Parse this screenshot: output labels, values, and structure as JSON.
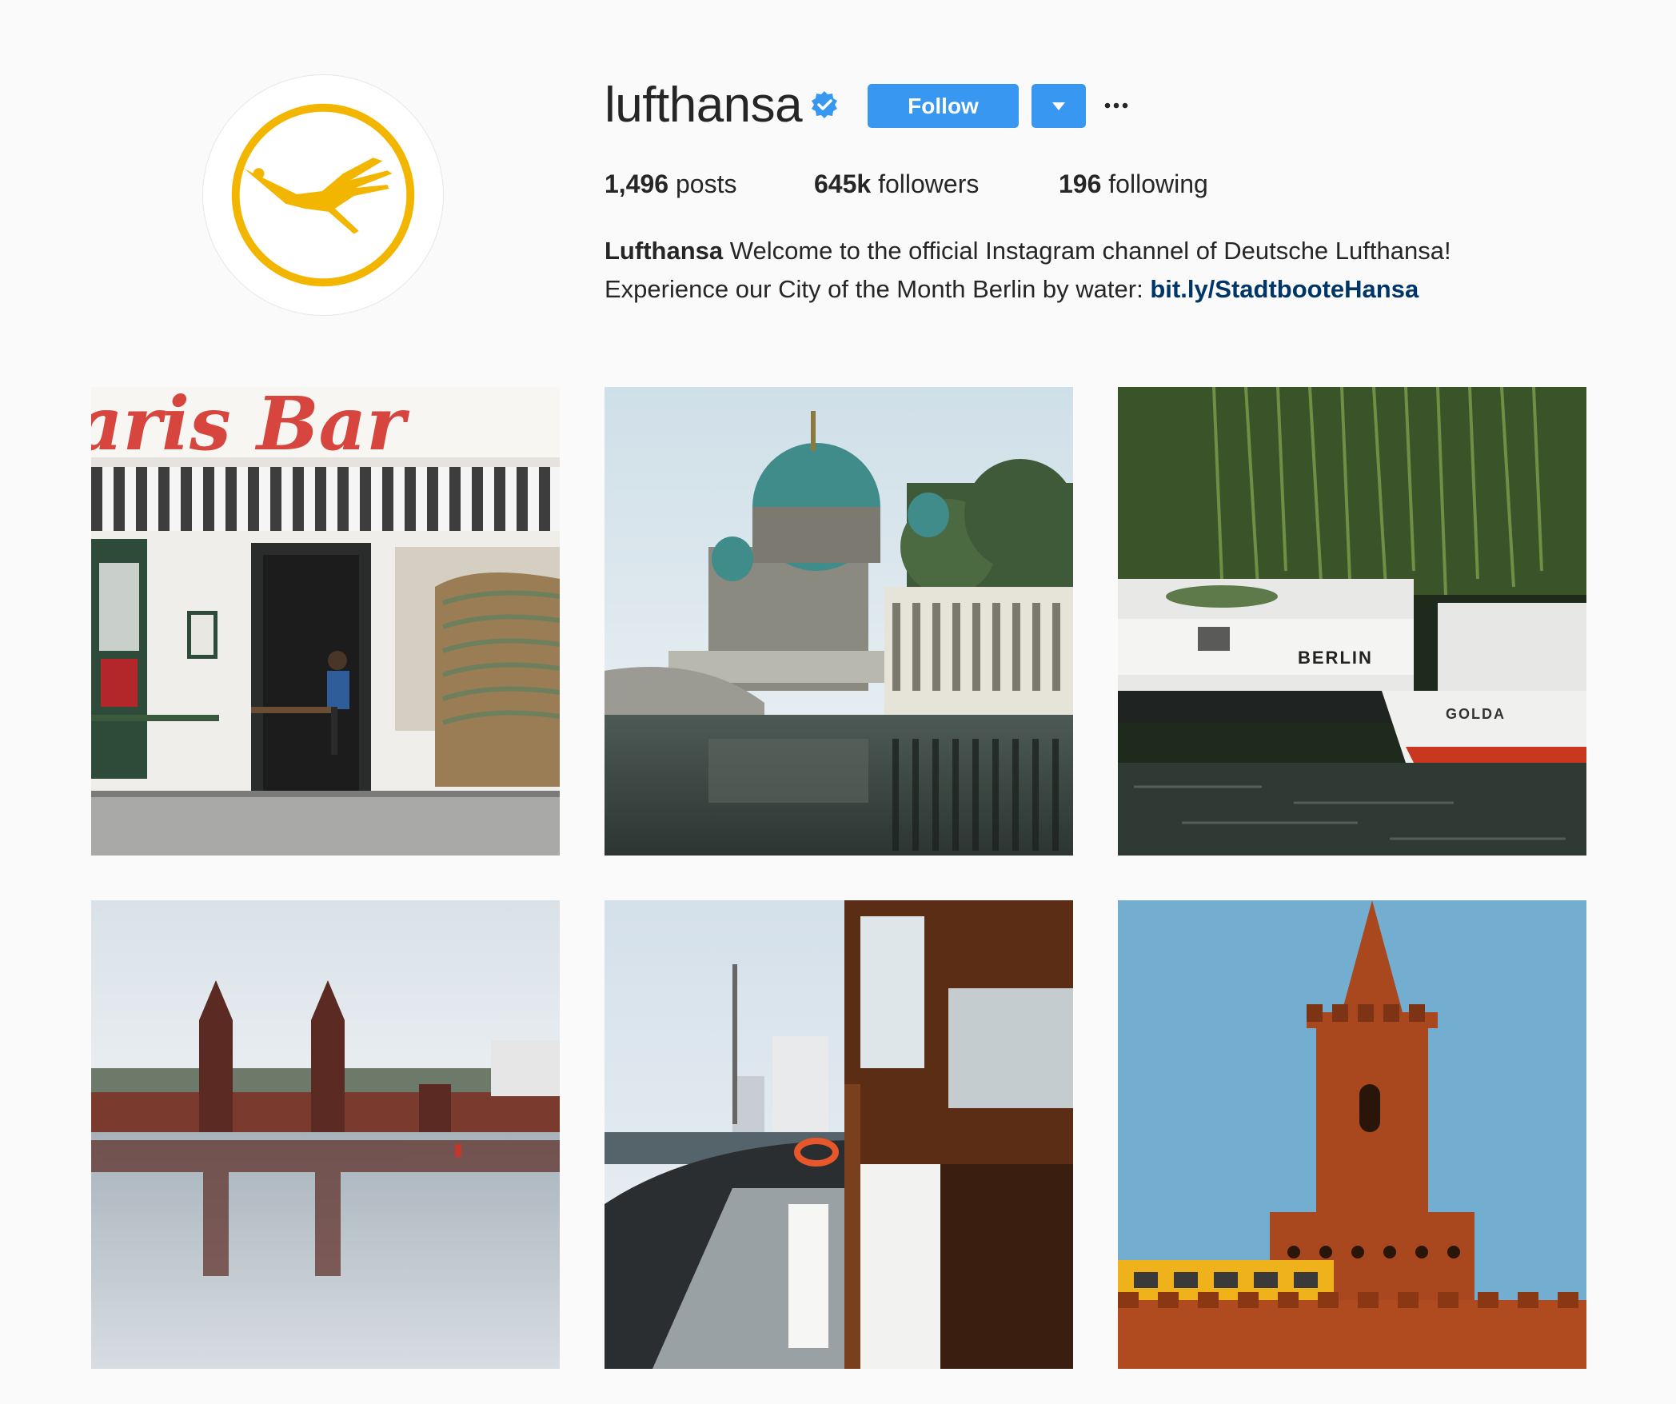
{
  "profile": {
    "username": "lufthansa",
    "verified": true,
    "follow_label": "Follow",
    "dropdown_icon": "caret-down-icon",
    "more_icon": "ellipsis-icon",
    "avatar_icon": "lufthansa-crane-logo",
    "stats": {
      "posts_count": "1,496",
      "posts_label": "posts",
      "followers_count": "645k",
      "followers_label": "followers",
      "following_count": "196",
      "following_label": "following"
    },
    "bio": {
      "name": "Lufthansa",
      "line1": "Welcome to the official Instagram channel of Deutsche Lufthansa!",
      "line2": "Experience our City of the Month Berlin by water:",
      "link": "bit.ly/StadtbooteHansa"
    }
  },
  "posts": [
    {
      "sign_text": "aris Bar"
    },
    {},
    {
      "boat_name_1": "BERLIN",
      "boat_name_2": "GOLDA"
    },
    {},
    {},
    {}
  ],
  "colors": {
    "accent": "#3897f0",
    "link": "#003569",
    "logo_yellow": "#f2b600",
    "background": "#fafafa"
  }
}
